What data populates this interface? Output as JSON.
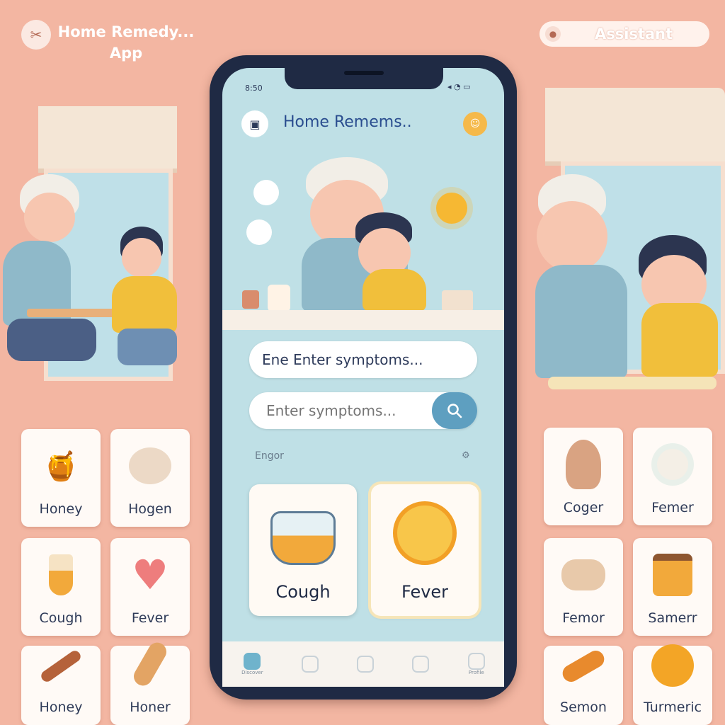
{
  "header": {
    "app_title": "Home Remedy...\nApp",
    "assistant_label": "Assistant"
  },
  "phone": {
    "status_left": "8:50",
    "status_right": "◂ ◔ ▭",
    "title": "Home Remems..",
    "input_top_value": "Ene Enter symptoms...",
    "search_placeholder": "Enter symptoms...",
    "section_label": "Engor",
    "tiles": [
      {
        "label": "Cough",
        "icon": "honey-jar-icon"
      },
      {
        "label": "Fever",
        "icon": "orange-slice-icon"
      }
    ],
    "nav": [
      {
        "label": "Discover",
        "active": true
      },
      {
        "label": "",
        "active": false
      },
      {
        "label": "",
        "active": false
      },
      {
        "label": "",
        "active": false
      },
      {
        "label": "Profile",
        "active": false
      }
    ]
  },
  "left_cards": [
    {
      "label": "Honey",
      "icon": "honey-pot-icon"
    },
    {
      "label": "Hogen",
      "icon": "ginger-ball-icon"
    },
    {
      "label": "Cough",
      "icon": "vial-icon"
    },
    {
      "label": "Fever",
      "icon": "heart-icon"
    },
    {
      "label": "Honey",
      "icon": "honey-dipper-icon"
    },
    {
      "label": "Honer",
      "icon": "ginger-root-icon"
    }
  ],
  "right_cards": [
    {
      "label": "Coger",
      "icon": "garlic-icon"
    },
    {
      "label": "Femer",
      "icon": "flower-icon"
    },
    {
      "label": "Femor",
      "icon": "ginger-icon"
    },
    {
      "label": "Samerr",
      "icon": "jar-icon"
    },
    {
      "label": "Semon",
      "icon": "turmeric-icon"
    },
    {
      "label": "Turmeric",
      "icon": "orange-icon"
    }
  ],
  "colors": {
    "background": "#f3b6a2",
    "phone_frame": "#1f2a44",
    "screen": "#bfe0e6",
    "accent": "#5e9fc0"
  }
}
